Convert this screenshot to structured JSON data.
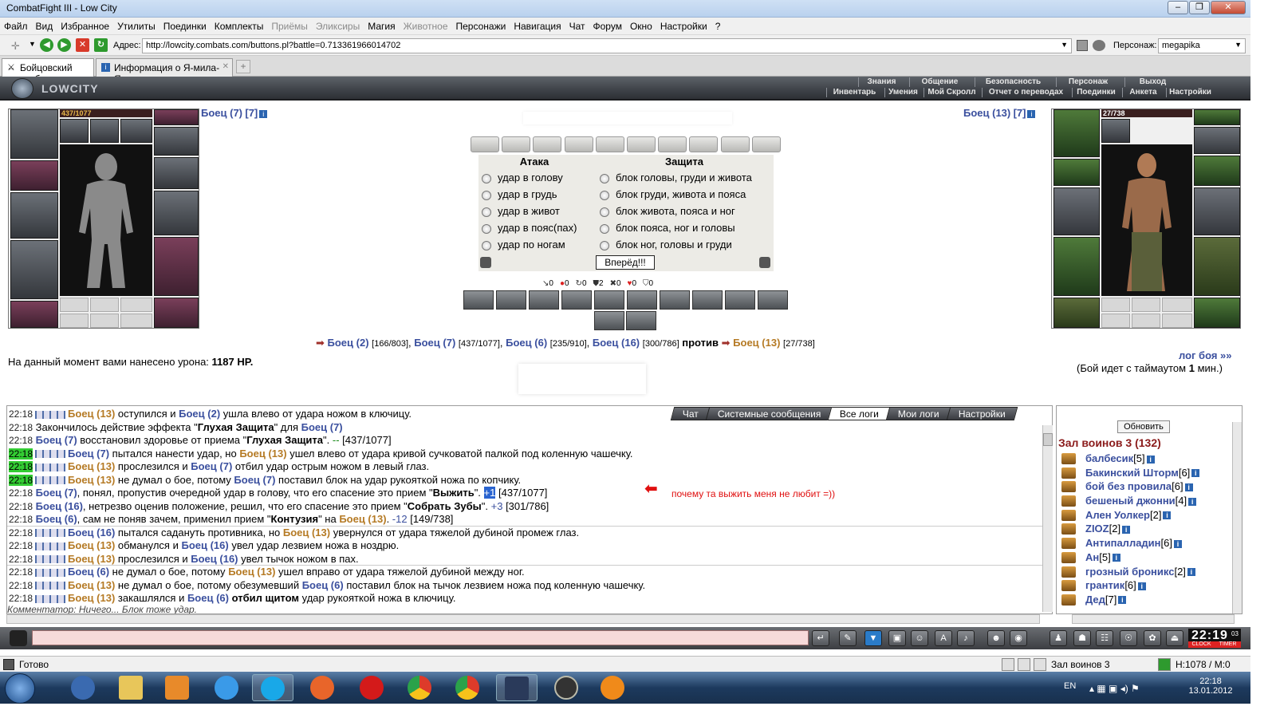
{
  "window": {
    "title": "CombatFight III - Low City"
  },
  "menu": [
    {
      "label": "Файл",
      "disabled": false
    },
    {
      "label": "Вид",
      "disabled": false
    },
    {
      "label": "Избранное",
      "disabled": false
    },
    {
      "label": "Утилиты",
      "disabled": false
    },
    {
      "label": "Поединки",
      "disabled": false
    },
    {
      "label": "Комплекты",
      "disabled": false
    },
    {
      "label": "Приёмы",
      "disabled": true
    },
    {
      "label": "Эликсиры",
      "disabled": true
    },
    {
      "label": "Магия",
      "disabled": false
    },
    {
      "label": "Животное",
      "disabled": true
    },
    {
      "label": "Персонажи",
      "disabled": false
    },
    {
      "label": "Навигация",
      "disabled": false
    },
    {
      "label": "Чат",
      "disabled": false
    },
    {
      "label": "Форум",
      "disabled": false
    },
    {
      "label": "Окно",
      "disabled": false
    },
    {
      "label": "Настройки",
      "disabled": false
    },
    {
      "label": "?",
      "disabled": false
    }
  ],
  "address": {
    "label": "Адрес:",
    "url": "http://lowcity.combats.com/buttons.pl?battle=0.713361966014702",
    "char_label": "Персонаж:",
    "char_value": "megapika"
  },
  "tabs": [
    {
      "label": "Бойцовский клуб"
    },
    {
      "label": "Информация о Я-мила-Я"
    }
  ],
  "game_nav": {
    "logo": "LOWCITY",
    "top": [
      "Знания",
      "Общение",
      "Безопасность",
      "Персонаж",
      "Выход"
    ],
    "bottom": [
      "Инвентарь",
      "Умения",
      "Мой Скролл",
      "Отчет о переводах",
      "Поединки",
      "Анкета",
      "Настройки"
    ]
  },
  "left_fighter": {
    "name": "Боец (7)",
    "level": "[7]",
    "hp": "437/1077"
  },
  "right_fighter": {
    "name": "Боец (13)",
    "level": "[7]",
    "hp": "27/738"
  },
  "attack": {
    "attack_header": "Атака",
    "defense_header": "Защита",
    "attacks": [
      "удар в голову",
      "удар в грудь",
      "удар в живот",
      "удар в пояс(пах)",
      "удар по ногам"
    ],
    "defenses": [
      "блок головы, груди и живота",
      "блок груди, живота и пояса",
      "блок живота, пояса и ног",
      "блок пояса, ног и головы",
      "блок ног, головы и груди"
    ],
    "go_label": "Вперёд!!!"
  },
  "counters": [
    "0",
    "0",
    "0",
    "2",
    "0",
    "0",
    "0"
  ],
  "battle": {
    "allies": [
      {
        "name": "Боец (2)",
        "hp": "[166/803]"
      },
      {
        "name": "Боец (7)",
        "hp": "[437/1077]"
      },
      {
        "name": "Боец (6)",
        "hp": "[235/910]"
      },
      {
        "name": "Боец (16)",
        "hp": "[300/786]"
      }
    ],
    "vs": "против",
    "enemy": {
      "name": "Боец (13)",
      "hp": "[27/738]"
    },
    "damage_label": "На данный момент вами нанесено урона:",
    "damage_value": "1187 HP.",
    "log_link": "лог боя »»",
    "timeout_pre": "(Бой идет с таймаутом",
    "timeout_val": "1",
    "timeout_post": "мин.)"
  },
  "log_tabs": [
    "Чат",
    "Системные сообщения",
    "Все логи",
    "Мои логи",
    "Настройки"
  ],
  "log": [
    {
      "t": "22:18",
      "g": false,
      "sq": true,
      "html": "<span class='br'>Боец (13)</span> оступился и <span class='bl'>Боец (2)</span> ушла влево от удара ножом в ключицу."
    },
    {
      "t": "22:18",
      "g": false,
      "sq": false,
      "html": "Закончилось действие эффекта \"<b>Глухая Защита</b>\" для <span class='bl'>Боец (7)</span>"
    },
    {
      "t": "22:18",
      "g": false,
      "sq": false,
      "html": "<span class='bl'>Боец (7)</span> восстановил здоровье от приема \"<b>Глухая Защита</b>\". <span style='color:#1a8a1a'>--</span> [437/1077]"
    },
    {
      "t": "22:18",
      "g": true,
      "sq": true,
      "html": "<span class='bl'>Боец (7)</span> пытался нанести удар, но <span class='br'>Боец (13)</span> ушел влево от удара кривой сучковатой палкой под коленную чашечку."
    },
    {
      "t": "22:18",
      "g": true,
      "sq": true,
      "html": "<span class='br'>Боец (13)</span> прослезился и <span class='bl'>Боец (7)</span> отбил удар острым ножом в левый глаз."
    },
    {
      "t": "22:18",
      "g": true,
      "sq": true,
      "html": "<span class='br'>Боец (13)</span> не думал о бое, потому <span class='bl'>Боец (7)</span> поставил блок на удар рукояткой ножа по копчику."
    },
    {
      "t": "22:18",
      "g": false,
      "sq": false,
      "html": "<span class='bl'>Боец (7)</span>, понял, пропустив очередной удар в голову, что его спасение это прием \"<b>Выжить</b>\". <span style='background:#2a64d0;color:#fff'>+1</span> [437/1077]"
    },
    {
      "t": "22:18",
      "g": false,
      "sq": false,
      "html": "<span class='bl'>Боец (16)</span>, нетрезво оценив положение, решил, что его спасение это прием \"<b>Собрать Зубы</b>\". <span style='color:#3a4f9e'>+3</span> [301/786]"
    },
    {
      "t": "22:18",
      "g": false,
      "sq": false,
      "html": "<span class='bl'>Боец (6)</span>, сам не поняв зачем, применил прием \"<b>Контузия</b>\" на <span class='br'>Боец (13)</span>. <span style='color:#3a4f9e'>-12</span> [149/738]"
    },
    {
      "t": "22:18",
      "g": false,
      "sq": true,
      "html": "<span class='bl'>Боец (16)</span> пытался садануть противника, но <span class='br'>Боец (13)</span> увернулся от удара тяжелой дубиной промеж глаз."
    },
    {
      "t": "22:18",
      "g": false,
      "sq": true,
      "html": "<span class='br'>Боец (13)</span> обманулся и <span class='bl'>Боец (16)</span> увел удар лезвием ножа в ноздрю."
    },
    {
      "t": "22:18",
      "g": false,
      "sq": true,
      "html": "<span class='br'>Боец (13)</span> прослезился и <span class='bl'>Боец (16)</span> увел тычок ножом в пах."
    },
    {
      "t": "22:18",
      "g": false,
      "sq": true,
      "html": "<span class='bl'>Боец (6)</span> не думал о бое, потому <span class='br'>Боец (13)</span> ушел вправо от удара тяжелой дубиной между ног."
    },
    {
      "t": "22:18",
      "g": false,
      "sq": true,
      "html": "<span class='br'>Боец (13)</span> не думал о бое, потому обезумевший <span class='bl'>Боец (6)</span> поставил блок на тычок лезвием ножа под коленную чашечку."
    },
    {
      "t": "22:18",
      "g": false,
      "sq": true,
      "html": "<span class='br'>Боец (13)</span> закашлялся и <span class='bl'>Боец (6)</span> <b>отбил щитом</b> удар рукояткой ножа в ключицу."
    }
  ],
  "log_footer": "Комментатор: Ничего... Блок тоже удар.",
  "annotation": "почему та выжить меня не любит   =))",
  "side": {
    "refresh": "Обновить",
    "title": "Зал воинов 3 (132)",
    "people": [
      {
        "name": "балбесик",
        "lv": "[5]"
      },
      {
        "name": "Бакинский Шторм",
        "lv": "[6]"
      },
      {
        "name": "бой без провила",
        "lv": "[6]"
      },
      {
        "name": "бешеный джонни",
        "lv": "[4]"
      },
      {
        "name": "Ален Уолкер",
        "lv": "[2]"
      },
      {
        "name": "ZIOZ",
        "lv": "[2]"
      },
      {
        "name": "Антипалладин",
        "lv": "[6]"
      },
      {
        "name": "Ан",
        "lv": "[5]"
      },
      {
        "name": "грозный броникс",
        "lv": "[2]"
      },
      {
        "name": "грантик",
        "lv": "[6]"
      },
      {
        "name": "Дед",
        "lv": "[7]"
      }
    ]
  },
  "clock_widget": {
    "time": "22:19",
    "sec": "03",
    "l1": "CLOCK",
    "l2": "TIMER"
  },
  "status": {
    "text": "Готово",
    "room": "Зал воинов 3",
    "stat": "H:1078 / M:0"
  },
  "taskbar": {
    "lang": "EN",
    "time": "22:18",
    "date": "13.01.2012"
  },
  "colors": {
    "ally": "#3a4f9e",
    "enemy": "#b57a24",
    "accent_green": "#33cc33"
  }
}
